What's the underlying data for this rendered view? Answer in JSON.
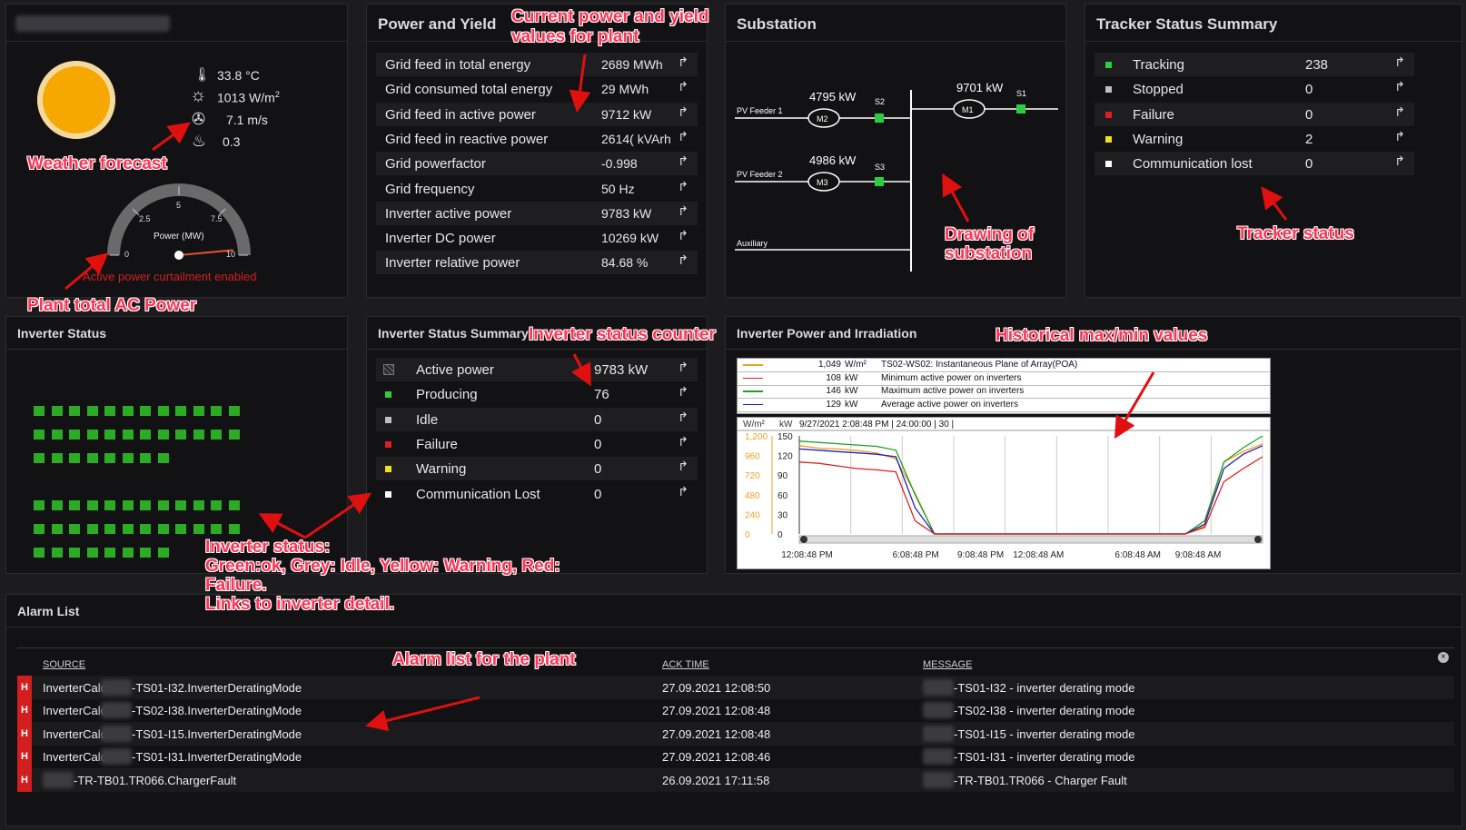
{
  "weather": {
    "temperature": "33.8 °C",
    "irradiance_value": "1013 W/m",
    "irradiance_sup": "2",
    "wind": "7.1 m/s",
    "humidity": "0.3",
    "gauge_title": "Power (MW)",
    "gauge_ticks": [
      "0",
      "2.5",
      "5",
      "7.5",
      "10"
    ],
    "gauge_level_mw": 9.7,
    "curtailment_text": "Active power curtailment enabled"
  },
  "power_yield": {
    "title": "Power and Yield",
    "rows": [
      {
        "label": "Grid feed in total energy",
        "value": "2689 MWh"
      },
      {
        "label": "Grid consumed total energy",
        "value": "29 MWh"
      },
      {
        "label": "Grid feed in active power",
        "value": "9712 kW"
      },
      {
        "label": "Grid feed in reactive power",
        "value": "2614( kVArh"
      },
      {
        "label": "Grid powerfactor",
        "value": "-0.998"
      },
      {
        "label": "Grid frequency",
        "value": "50 Hz"
      },
      {
        "label": "Inverter active power",
        "value": "9783 kW"
      },
      {
        "label": "Inverter DC power",
        "value": "10269 kW"
      },
      {
        "label": "Inverter relative power",
        "value": "84.68 %"
      }
    ]
  },
  "substation": {
    "title": "Substation",
    "feeder1": "PV Feeder 1",
    "feeder2": "PV Feeder 2",
    "auxiliary": "Auxiliary",
    "m1_value": "9701 kW",
    "m2_value": "4795 kW",
    "m3_value": "4986 kW",
    "m1": "M1",
    "m2": "M2",
    "m3": "M3",
    "s1": "S1",
    "s2": "S2",
    "s3": "S3"
  },
  "tracker": {
    "title": "Tracker Status Summary",
    "rows": [
      {
        "label": "Tracking",
        "value": "238",
        "color": "#2ecc40"
      },
      {
        "label": "Stopped",
        "value": "0",
        "color": "#bfbfbf"
      },
      {
        "label": "Failure",
        "value": "0",
        "color": "#e02020"
      },
      {
        "label": "Warning",
        "value": "2",
        "color": "#f0e020"
      },
      {
        "label": "Communication lost",
        "value": "0",
        "color": "#ffffff"
      }
    ]
  },
  "inverter_status": {
    "title": "Inverter Status",
    "color_ok": "#2cab24"
  },
  "inverter_summary": {
    "title": "Inverter Status Summary",
    "rows": [
      {
        "label": "Active power",
        "value": "9783 kW",
        "color": "#555"
      },
      {
        "label": "Producing",
        "value": "76",
        "color": "#2ecc40"
      },
      {
        "label": "Idle",
        "value": "0",
        "color": "#bfbfbf"
      },
      {
        "label": "Failure",
        "value": "0",
        "color": "#e02020"
      },
      {
        "label": "Warning",
        "value": "0",
        "color": "#f0e020"
      },
      {
        "label": "Communication Lost",
        "value": "0",
        "color": "#ffffff"
      }
    ]
  },
  "irradiation": {
    "title": "Inverter Power and Irradiation",
    "legend": [
      {
        "value": "1,049",
        "unit": "W/m²",
        "desc": "TS02-WS02: Instantaneous Plane of Array(POA)",
        "color": "#f0a020"
      },
      {
        "value": "108",
        "unit": "kW",
        "desc": "Minimum active power on inverters",
        "color": "#e02020"
      },
      {
        "value": "146",
        "unit": "kW",
        "desc": "Maximum active power on inverters",
        "color": "#20a020"
      },
      {
        "value": "129",
        "unit": "kW",
        "desc": "Average active power on inverters",
        "color": "#2020c0"
      }
    ],
    "header_left_unit": "W/m²",
    "header_right_unit": "kW",
    "header_info": "9/27/2021 2:08:48 PM | 24:00:00 | 30 |"
  },
  "chart_data": {
    "type": "line",
    "title": "",
    "y_left": {
      "label": "W/m²",
      "ticks": [
        "1,200",
        "960",
        "720",
        "480",
        "240",
        "0"
      ],
      "range": [
        0,
        1200
      ]
    },
    "y_right": {
      "label": "kW",
      "ticks": [
        "150",
        "120",
        "90",
        "60",
        "30",
        "0"
      ],
      "range": [
        0,
        150
      ]
    },
    "x_ticks": [
      "12:08:48 PM",
      "6:08:48 PM",
      "9:08:48 PM",
      "12:08:48 AM",
      "6:08:48 AM",
      "9:08:48 AM"
    ],
    "x": [
      0,
      1,
      2,
      3,
      4,
      5,
      6,
      7,
      8,
      9,
      10,
      11,
      12,
      13,
      14,
      15,
      16,
      17,
      18,
      19,
      20,
      21,
      22,
      23,
      24
    ],
    "series": [
      {
        "name": "TS02-WS02: Instantaneous Plane of Array(POA)",
        "axis": "left",
        "color": "#f0a020",
        "values": [
          1080,
          1050,
          1040,
          1020,
          990,
          920,
          500,
          0,
          0,
          0,
          0,
          0,
          0,
          0,
          0,
          0,
          0,
          0,
          0,
          0,
          0,
          100,
          880,
          1010,
          1100
        ]
      },
      {
        "name": "Maximum active power on inverters",
        "axis": "right",
        "color": "#20a020",
        "values": [
          142,
          140,
          138,
          136,
          134,
          128,
          60,
          0,
          0,
          0,
          0,
          0,
          0,
          0,
          0,
          0,
          0,
          0,
          0,
          0,
          0,
          20,
          110,
          132,
          150
        ]
      },
      {
        "name": "Average active power on inverters",
        "axis": "right",
        "color": "#2020c0",
        "values": [
          130,
          128,
          126,
          124,
          122,
          118,
          40,
          0,
          0,
          0,
          0,
          0,
          0,
          0,
          0,
          0,
          0,
          0,
          0,
          0,
          0,
          15,
          100,
          122,
          135
        ]
      },
      {
        "name": "Minimum active power on inverters",
        "axis": "right",
        "color": "#e02020",
        "values": [
          110,
          108,
          104,
          100,
          98,
          95,
          20,
          0,
          0,
          0,
          0,
          0,
          0,
          0,
          0,
          0,
          0,
          0,
          0,
          0,
          0,
          10,
          80,
          100,
          118
        ]
      }
    ]
  },
  "alarm": {
    "title": "Alarm List",
    "headers": [
      "SOURCE",
      "ACK TIME",
      "MESSAGE"
    ],
    "rows": [
      {
        "badge": "H",
        "source_pre": "InverterCalc",
        "source_post": "-TS01-I32.InverterDeratingMode",
        "ack": "27.09.2021 12:08:50",
        "message": "-TS01-I32 - inverter derating mode"
      },
      {
        "badge": "H",
        "source_pre": "InverterCalc",
        "source_post": "-TS02-I38.InverterDeratingMode",
        "ack": "27.09.2021 12:08:48",
        "message": "-TS02-I38 - inverter derating mode"
      },
      {
        "badge": "H",
        "source_pre": "InverterCalc",
        "source_post": "-TS01-I15.InverterDeratingMode",
        "ack": "27.09.2021 12:08:48",
        "message": "-TS01-I15 - inverter derating mode"
      },
      {
        "badge": "H",
        "source_pre": "InverterCalc",
        "source_post": "-TS01-I31.InverterDeratingMode",
        "ack": "27.09.2021 12:08:46",
        "message": "-TS01-I31 - inverter derating mode"
      },
      {
        "badge": "H",
        "source_pre": "",
        "source_post": "-TR-TB01.TR066.ChargerFault",
        "ack": "26.09.2021 17:11:58",
        "message": "-TR-TB01.TR066 - Charger Fault"
      }
    ]
  },
  "annotations": {
    "weather": "Weather forecast",
    "plant_ac": "Plant total AC Power",
    "power_yield_1": "Current power and yield",
    "power_yield_2": "values for plant",
    "substation_1": "Drawing of",
    "substation_2": "substation",
    "tracker": "Tracker status",
    "inv_counter": "Inverter status counter",
    "hist": "Historical max/min values",
    "inv_status_1": "Inverter status:",
    "inv_status_2": "Green:ok, Grey: Idle, Yellow: Warning, Red:",
    "inv_status_3": "Failure.",
    "inv_status_4": "Links to inverter detail.",
    "alarm": "Alarm list for the plant"
  }
}
